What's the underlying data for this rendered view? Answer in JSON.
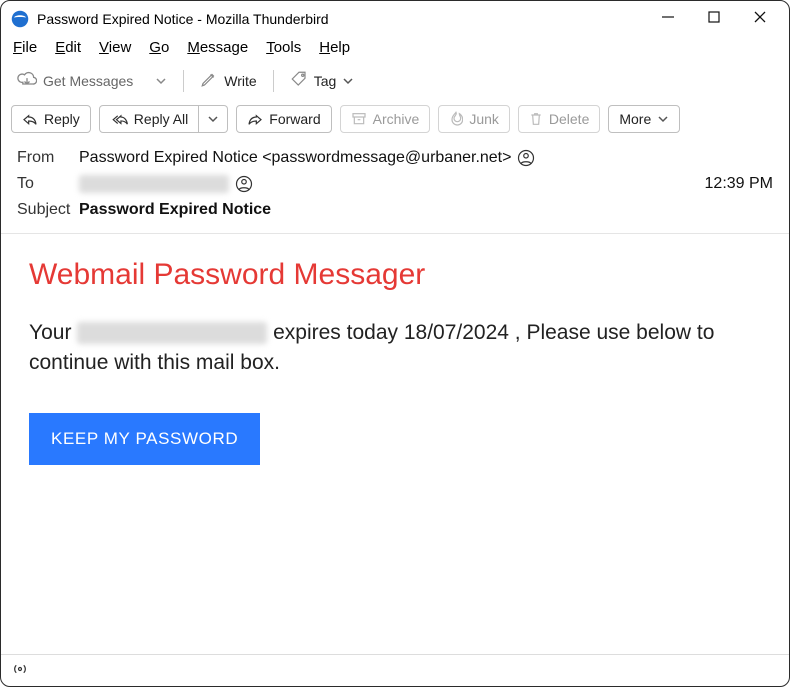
{
  "window": {
    "title": "Password Expired Notice - Mozilla Thunderbird"
  },
  "menubar": {
    "file": "File",
    "edit": "Edit",
    "view": "View",
    "go": "Go",
    "message": "Message",
    "tools": "Tools",
    "help": "Help"
  },
  "toolbar1": {
    "get_messages": "Get Messages",
    "write": "Write",
    "tag": "Tag"
  },
  "toolbar2": {
    "reply": "Reply",
    "reply_all": "Reply All",
    "forward": "Forward",
    "archive": "Archive",
    "junk": "Junk",
    "delete": "Delete",
    "more": "More"
  },
  "headers": {
    "from_label": "From",
    "from_value": "Password Expired Notice <passwordmessage@urbaner.net>",
    "to_label": "To",
    "time": "12:39 PM",
    "subject_label": "Subject",
    "subject_value": "Password Expired Notice"
  },
  "body": {
    "title": "Webmail Password Messager",
    "para_before": "Your ",
    "para_after": " expires today 18/07/2024 , Please use below to continue with this mail box.",
    "cta": "KEEP MY PASSWORD"
  }
}
